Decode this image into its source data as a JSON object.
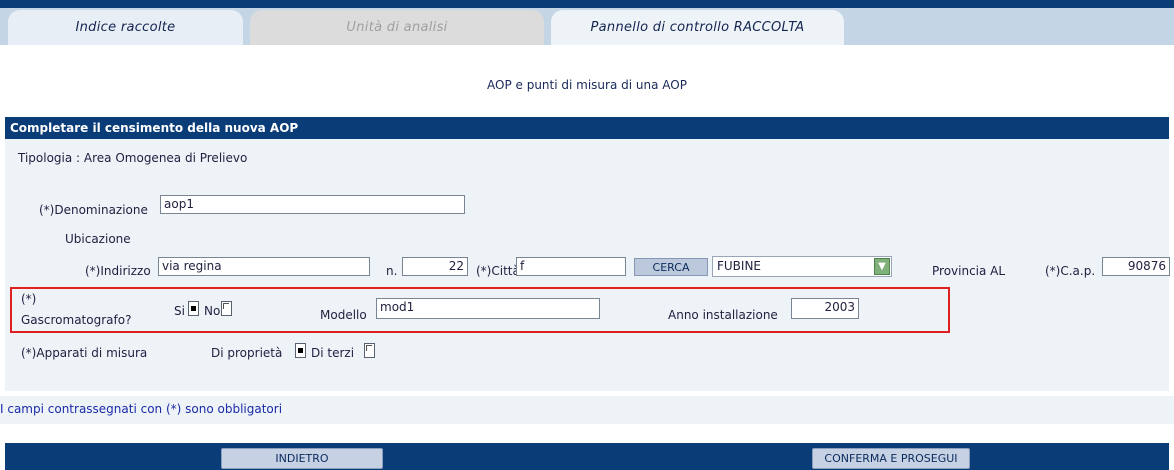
{
  "tabs": {
    "indice": "Indice raccolte",
    "unita": "Unità di analisi",
    "pannello": "Pannello di controllo RACCOLTA"
  },
  "page_title": "AOP e punti di misura di una AOP",
  "section_header": "Completare il censimento della nuova AOP",
  "tipologia": "Tipologia : Area Omogenea di Prelievo",
  "form": {
    "denominazione_label": "(*)Denominazione",
    "denominazione_value": "aop1",
    "ubicazione_label": "Ubicazione",
    "indirizzo_label": "(*)Indirizzo",
    "indirizzo_value": "via regina",
    "numero_label": "n.",
    "numero_value": "22",
    "citta_label": "(*)Città",
    "citta_value": "f",
    "cerca_label": "CERCA",
    "comune_selected": "FUBINE",
    "provincia_label": "Provincia AL",
    "cap_label": "(*)C.a.p.",
    "cap_value": "90876",
    "gas_label_line1": "(*)",
    "gas_label_line2": "Gascromatografo?",
    "si_label": "Si",
    "no_label": "No",
    "modello_label": "Modello",
    "modello_value": "mod1",
    "anno_label": "Anno installazione",
    "anno_value": "2003",
    "apparati_label": "(*)Apparati di misura",
    "proprieta_label": "Di proprietà",
    "terzi_label": "Di terzi"
  },
  "note": "I campi contrassegnati con (*) sono obbligatori",
  "buttons": {
    "indietro": "INDIETRO",
    "conferma": "CONFERMA E PROSEGUI"
  },
  "colors": {
    "header_blue": "#0a3c78",
    "panel_bg": "#eef3f8",
    "highlight_red": "#e02020"
  }
}
